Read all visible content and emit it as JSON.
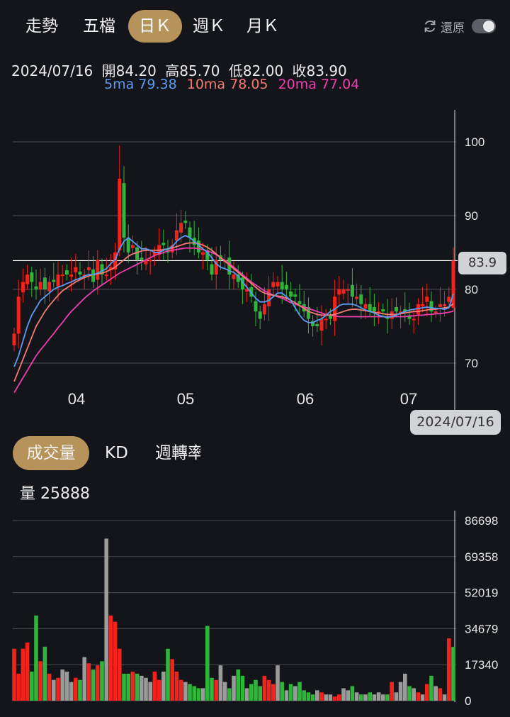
{
  "tabs": [
    {
      "label": "走勢",
      "active": false
    },
    {
      "label": "五檔",
      "active": false
    },
    {
      "label": "日Ｋ",
      "active": true
    },
    {
      "label": "週Ｋ",
      "active": false
    },
    {
      "label": "月Ｋ",
      "active": false
    }
  ],
  "restore": {
    "label": "還原",
    "icon": "refresh-icon",
    "toggle_on": false
  },
  "info": {
    "date": "2024/07/16",
    "open_label": "開",
    "open": "84.20",
    "high_label": "高",
    "high": "85.70",
    "low_label": "低",
    "low": "82.00",
    "close_label": "收",
    "close": "83.90",
    "ma5_label": "5ma",
    "ma5": "79.38",
    "ma10_label": "10ma",
    "ma10": "78.05",
    "ma20_label": "20ma",
    "ma20": "77.04"
  },
  "price_axis": {
    "ticks": [
      "100",
      "90",
      "80",
      "70"
    ],
    "current": "83.9"
  },
  "month_labels": [
    "04",
    "05",
    "06",
    "07"
  ],
  "cursor_date": "2024/07/16",
  "sub_tabs": [
    {
      "label": "成交量",
      "active": true
    },
    {
      "label": "KD",
      "active": false
    },
    {
      "label": "週轉率",
      "active": false
    }
  ],
  "volume": {
    "label": "量",
    "value": "25888",
    "ticks": [
      "86698",
      "69358",
      "52019",
      "34679",
      "17340",
      "0"
    ]
  },
  "colors": {
    "up": "#f2231c",
    "down": "#2fb53a",
    "neutral": "#9a9a9a",
    "ma5": "#5b9bf0",
    "ma10": "#f47b74",
    "ma20": "#ee3fae",
    "accent": "#b7935c",
    "grid": "#4a4d53"
  },
  "chart_data": {
    "type": "candlestick",
    "last_bar": {
      "date": "2024/07/16",
      "open": 84.2,
      "high": 85.7,
      "low": 82.0,
      "close": 83.9,
      "volume": 25888
    },
    "price_range": [
      66,
      104
    ],
    "price_ticks": [
      100,
      90,
      80,
      70
    ],
    "volume_range": [
      0,
      90000
    ],
    "volume_ticks": [
      86698,
      69358,
      52019,
      34679,
      17340,
      0
    ],
    "closes": [
      74,
      79,
      81,
      82,
      81,
      80,
      81,
      80,
      81,
      81,
      82,
      82,
      82,
      82,
      83,
      82,
      82,
      83,
      81,
      84,
      82,
      82,
      83,
      85,
      95,
      87,
      85,
      86,
      84,
      84,
      84,
      84,
      85,
      86,
      86,
      85,
      86,
      88,
      89,
      89,
      87,
      86,
      85,
      85,
      84,
      82,
      84,
      84,
      84,
      82,
      82,
      81,
      80,
      80,
      79,
      77,
      76,
      78,
      80,
      81,
      81,
      80,
      80,
      79,
      79,
      78,
      77,
      76,
      75,
      75,
      76,
      76,
      76,
      79,
      80,
      80,
      80,
      79,
      79,
      78,
      78,
      77,
      77,
      77,
      77,
      76,
      77,
      77,
      77,
      77,
      76,
      76,
      78,
      78,
      79,
      77,
      77,
      78,
      78,
      79,
      83.9
    ],
    "volumes": [
      25000,
      13000,
      25000,
      28000,
      14000,
      41000,
      19000,
      26000,
      13000,
      10000,
      11000,
      15000,
      14000,
      9000,
      11000,
      10000,
      21000,
      18000,
      15000,
      17000,
      19000,
      78000,
      41000,
      38000,
      25000,
      13000,
      13000,
      14000,
      13000,
      12000,
      11000,
      9000,
      14000,
      10000,
      14000,
      25000,
      20000,
      14000,
      10000,
      9000,
      8000,
      7000,
      6000,
      6000,
      36000,
      11000,
      10000,
      17000,
      9000,
      6000,
      12000,
      15000,
      12000,
      6000,
      8000,
      10000,
      7000,
      12000,
      10000,
      8000,
      17000,
      9000,
      5000,
      8000,
      7000,
      9000,
      5000,
      4000,
      3000,
      5000,
      4000,
      3000,
      3000,
      2000,
      3000,
      6000,
      5000,
      7000,
      4000,
      3000,
      3000,
      4000,
      3000,
      4000,
      3000,
      3000,
      9000,
      4000,
      9000,
      13000,
      7000,
      6000,
      4000,
      3000,
      8000,
      12000,
      7000,
      6000,
      3000,
      30000,
      25888
    ],
    "ma5": [
      69.5,
      71,
      73,
      75,
      76.5,
      77.5,
      78.5,
      79,
      79.5,
      80,
      80.3,
      80.5,
      80.8,
      81,
      81.3,
      81.5,
      81.8,
      82,
      82,
      82.2,
      82.5,
      82.8,
      83.5,
      84,
      85.5,
      86.5,
      87,
      86.5,
      86,
      85.5,
      85.5,
      85.3,
      85,
      85,
      85.3,
      85.5,
      85.8,
      86.5,
      87,
      87.3,
      87,
      86.5,
      86,
      85.5,
      85,
      84.3,
      83.5,
      83,
      82.8,
      82.5,
      82.3,
      81.8,
      81,
      80.3,
      79.5,
      78.8,
      78.3,
      78.3,
      78.5,
      79,
      79.5,
      79.5,
      79,
      78.5,
      77.5,
      76.5,
      75.8,
      75.5,
      75.5,
      75.8,
      76,
      76.5,
      77,
      77.3,
      77.8,
      78,
      78,
      78,
      77.8,
      77.5,
      77.2,
      77,
      76.8,
      76.5,
      76.3,
      76.2,
      76.3,
      76.5,
      76.8,
      77,
      77.2,
      77.3,
      77.4,
      77.5,
      77.6,
      77.5,
      77.4,
      77.4,
      77.3,
      77.5,
      79.38
    ],
    "ma10": [
      67.5,
      69,
      70.5,
      72,
      73.5,
      75,
      76,
      77,
      77.8,
      78.5,
      79.2,
      79.8,
      80.2,
      80.6,
      81,
      81.3,
      81.6,
      81.8,
      82,
      82.1,
      82.2,
      82.4,
      82.7,
      83,
      83.5,
      84,
      84.5,
      84.8,
      85,
      85.2,
      85.3,
      85.3,
      85.3,
      85.3,
      85.4,
      85.5,
      85.6,
      85.8,
      86,
      86.2,
      86.3,
      86.3,
      86.2,
      86,
      85.7,
      85.3,
      84.8,
      84.3,
      83.8,
      83.3,
      82.8,
      82.3,
      81.8,
      81.3,
      80.8,
      80.3,
      79.8,
      79.5,
      79.3,
      79.2,
      79.1,
      79,
      78.8,
      78.5,
      78.2,
      77.8,
      77.4,
      77,
      76.8,
      76.6,
      76.5,
      76.5,
      76.5,
      76.6,
      76.8,
      77,
      77.2,
      77.3,
      77.3,
      77.2,
      77.1,
      77,
      76.9,
      76.8,
      76.7,
      76.6,
      76.6,
      76.6,
      76.7,
      76.8,
      76.9,
      77,
      77,
      77.1,
      77.2,
      77.3,
      77.3,
      77.4,
      77.5,
      77.6,
      78.05
    ],
    "ma20": [
      66,
      67,
      68,
      69,
      70,
      71,
      71.8,
      72.5,
      73.3,
      74,
      74.8,
      75.5,
      76.3,
      77,
      77.6,
      78.2,
      78.8,
      79.3,
      79.8,
      80.2,
      80.6,
      81,
      81.4,
      81.8,
      82.2,
      82.5,
      82.8,
      83.1,
      83.4,
      83.7,
      84,
      84.3,
      84.6,
      84.8,
      85,
      85.2,
      85.3,
      85.4,
      85.5,
      85.6,
      85.6,
      85.6,
      85.5,
      85.4,
      85.2,
      85,
      84.7,
      84.3,
      83.9,
      83.5,
      83,
      82.5,
      82,
      81.5,
      81,
      80.6,
      80.2,
      79.8,
      79.5,
      79.2,
      79,
      78.8,
      78.5,
      78.2,
      78,
      77.8,
      77.6,
      77.4,
      77.2,
      77,
      76.8,
      76.6,
      76.5,
      76.4,
      76.3,
      76.3,
      76.3,
      76.3,
      76.3,
      76.3,
      76.3,
      76.3,
      76.3,
      76.3,
      76.3,
      76.3,
      76.3,
      76.3,
      76.3,
      76.3,
      76.4,
      76.4,
      76.5,
      76.5,
      76.6,
      76.6,
      76.7,
      76.7,
      76.8,
      76.9,
      77.04
    ]
  }
}
